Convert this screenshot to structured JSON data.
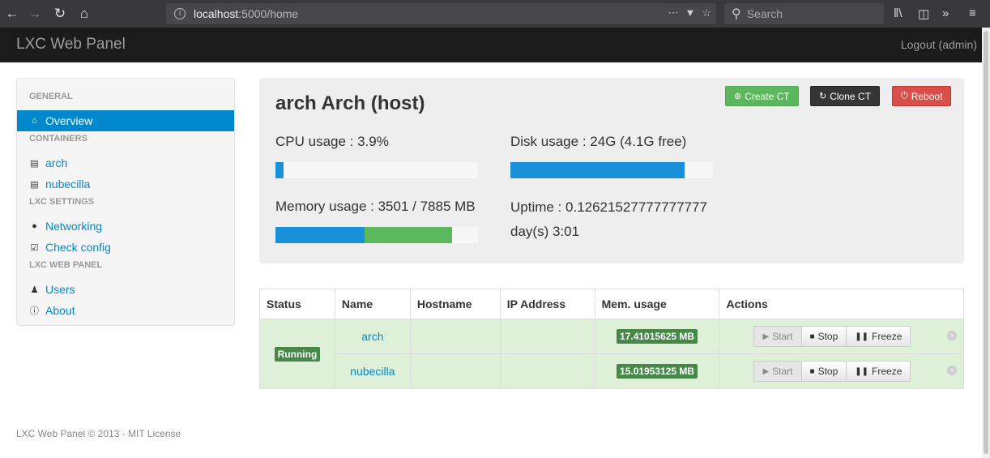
{
  "browser": {
    "url_host": "localhost",
    "url_path": ":5000/home",
    "search_placeholder": "Search"
  },
  "navbar": {
    "brand": "LXC Web Panel",
    "logout": "Logout (admin)"
  },
  "sidebar": {
    "sections": [
      {
        "header": "GENERAL",
        "items": [
          {
            "label": "Overview",
            "icon": "home-icon"
          }
        ]
      },
      {
        "header": "CONTAINERS",
        "items": [
          {
            "label": "arch",
            "icon": "hdd-icon"
          },
          {
            "label": "nubecilla",
            "icon": "hdd-icon"
          }
        ]
      },
      {
        "header": "LXC SETTINGS",
        "items": [
          {
            "label": "Networking",
            "icon": "globe-icon"
          },
          {
            "label": "Check config",
            "icon": "check-icon"
          }
        ]
      },
      {
        "header": "LXC WEB PANEL",
        "items": [
          {
            "label": "Users",
            "icon": "user-icon"
          },
          {
            "label": "About",
            "icon": "info-icon"
          }
        ]
      }
    ]
  },
  "hero": {
    "title": "arch Arch (host)",
    "buttons": {
      "create": "Create CT",
      "clone": "Clone CT",
      "reboot": "Reboot"
    },
    "cpu_label": "CPU usage : 3.9%",
    "cpu_fraction": 0.039,
    "disk_label": "Disk usage : 24G (4.1G free)",
    "disk_fraction": 0.86,
    "memory_label": "Memory usage : 3501 / 7885 MB",
    "memory_used_fraction": 0.44,
    "memory_cached_fraction": 0.43,
    "uptime_label": "Uptime : 0.12621527777777777 day(s) 3:01",
    "colors": {
      "bar_primary": "#1a90d8",
      "bar_secondary": "#5cb85c"
    }
  },
  "table": {
    "headers": [
      "Status",
      "Name",
      "Hostname",
      "IP Address",
      "Mem. usage",
      "Actions"
    ],
    "status": "Running",
    "rows": [
      {
        "name": "arch",
        "hostname": "",
        "ip": "",
        "mem": "17.41015625 MB"
      },
      {
        "name": "nubecilla",
        "hostname": "",
        "ip": "",
        "mem": "15.01953125 MB"
      }
    ],
    "actions": {
      "start": "Start",
      "stop": "Stop",
      "freeze": "Freeze"
    }
  },
  "footer": "LXC Web Panel © 2013 - MIT License"
}
